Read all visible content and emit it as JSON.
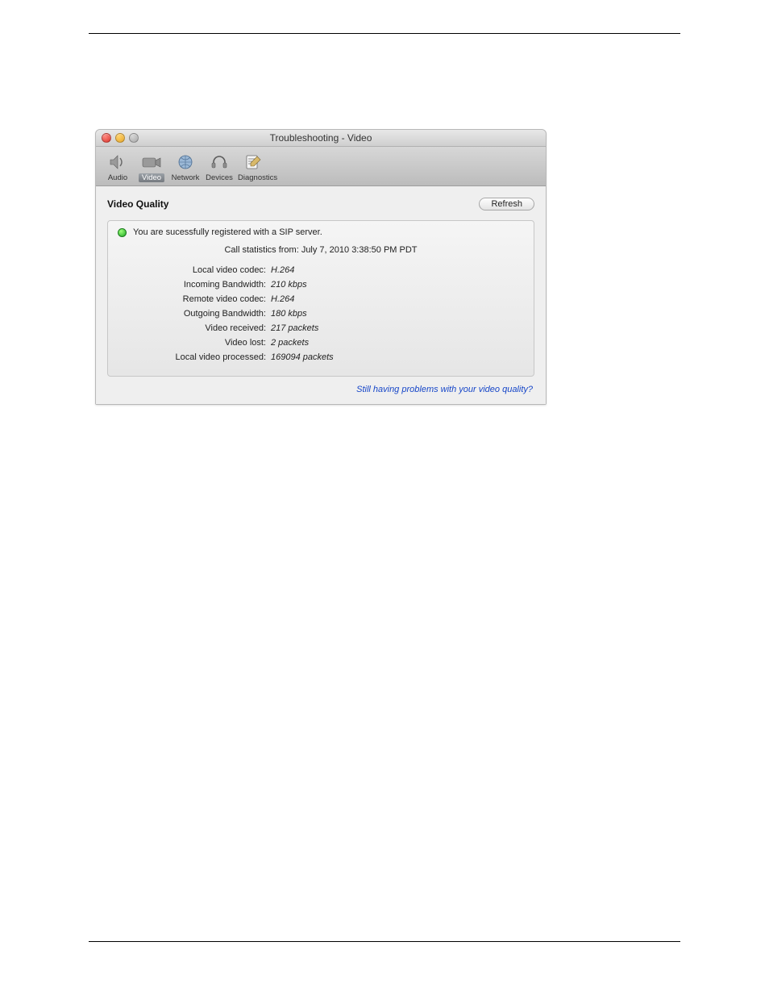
{
  "window": {
    "title": "Troubleshooting - Video",
    "toolbar": {
      "items": [
        {
          "label": "Audio"
        },
        {
          "label": "Video"
        },
        {
          "label": "Network"
        },
        {
          "label": "Devices"
        },
        {
          "label": "Diagnostics"
        }
      ],
      "selected_index": 1
    }
  },
  "section": {
    "title": "Video Quality",
    "refresh_label": "Refresh"
  },
  "status": {
    "text": "You are sucessfully registered with a SIP server.",
    "led": "green"
  },
  "stats": {
    "caption": "Call statistics from: July 7, 2010 3:38:50 PM PDT",
    "rows": [
      {
        "label": "Local video codec:",
        "value": "H.264"
      },
      {
        "label": "Incoming Bandwidth:",
        "value": "210 kbps"
      },
      {
        "label": "Remote video codec:",
        "value": "H.264"
      },
      {
        "label": "Outgoing Bandwidth:",
        "value": "180 kbps"
      },
      {
        "label": "Video received:",
        "value": "217 packets"
      },
      {
        "label": "Video lost:",
        "value": "2 packets"
      },
      {
        "label": "Local video processed:",
        "value": "169094 packets"
      }
    ]
  },
  "help_link": "Still having problems with your video quality?"
}
